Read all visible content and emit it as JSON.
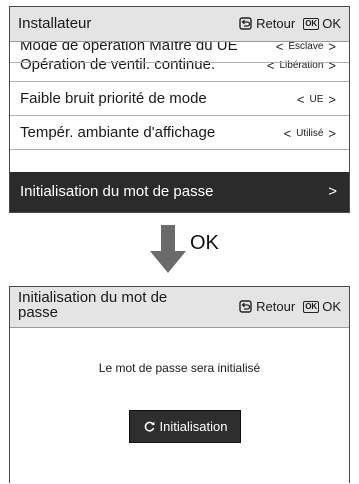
{
  "screen1": {
    "header": {
      "title": "Installateur",
      "back_label": "Retour",
      "ok_icon_text": "OK",
      "ok_label": "OK"
    },
    "partial_row": {
      "label": "Mode de opération Maître du UE",
      "value": "Esclave"
    },
    "rows": [
      {
        "label": "Opération de ventil. continue.",
        "value": "Libération"
      },
      {
        "label": "Faible bruit priorité de mode",
        "value": "UE"
      },
      {
        "label": "Tempér. ambiante d'affichage",
        "value": "Utilisé"
      }
    ],
    "selected_row": {
      "label": "Initialisation du mot de passe",
      "arrow": ">"
    }
  },
  "transition": {
    "label": "OK"
  },
  "screen2": {
    "header": {
      "title_line1": "Initialisation du mot de",
      "title_line2": "passe",
      "back_label": "Retour",
      "ok_icon_text": "OK",
      "ok_label": "OK"
    },
    "message": "Le mot de passe sera initialisé",
    "button_label": "Initialisation"
  },
  "colors": {
    "header_bg": "#e4e4e4",
    "selected_bg": "#2b2b2b",
    "arrow": "#6b6b6b"
  }
}
